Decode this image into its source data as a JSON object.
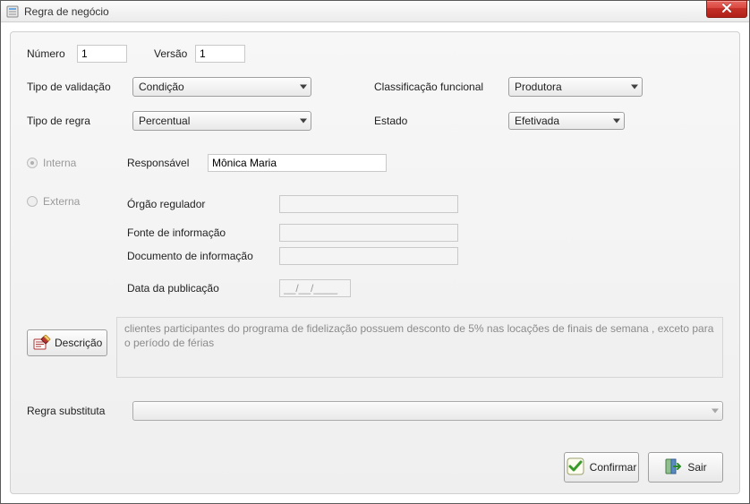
{
  "window": {
    "title": "Regra de negócio"
  },
  "top": {
    "numero_label": "Número",
    "numero_value": "1",
    "versao_label": "Versão",
    "versao_value": "1",
    "tipo_validacao_label": "Tipo de validação",
    "tipo_validacao_value": "Condição",
    "class_func_label": "Classificação funcional",
    "class_func_value": "Produtora",
    "tipo_regra_label": "Tipo de regra",
    "tipo_regra_value": "Percentual",
    "estado_label": "Estado",
    "estado_value": "Efetivada"
  },
  "source": {
    "interna_label": "Interna",
    "externa_label": "Externa",
    "responsavel_label": "Responsável",
    "responsavel_value": "Mônica Maria",
    "orgao_label": "Órgão regulador",
    "orgao_value": "",
    "fonte_label": "Fonte de informação",
    "fonte_value": "",
    "documento_label": "Documento de informação",
    "documento_value": "",
    "data_pub_label": "Data da publicação",
    "data_pub_placeholder": "__/__/____"
  },
  "description": {
    "button_label": "Descrição",
    "text": "clientes participantes do programa de fidelização  possuem desconto de 5% nas locações de finais de semana , exceto para o período de férias"
  },
  "substituta": {
    "label": "Regra substituta",
    "value": ""
  },
  "actions": {
    "confirmar": "Confirmar",
    "sair": "Sair"
  }
}
